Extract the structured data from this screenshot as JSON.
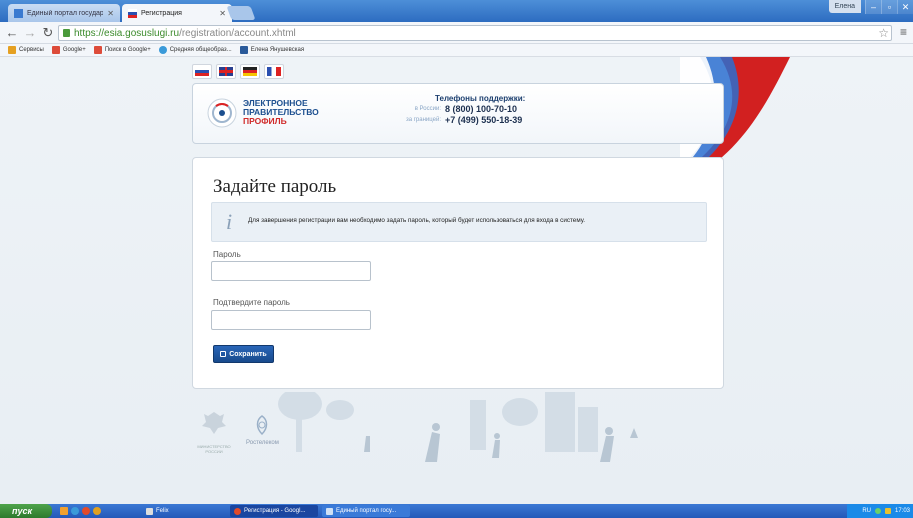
{
  "browser": {
    "tabs": [
      {
        "title": "Единый портал государств",
        "active": false
      },
      {
        "title": "Регистрация",
        "active": true
      }
    ],
    "user_label": "Елена",
    "url_scheme": "https://",
    "url_host": "esia.gosuslugi.ru",
    "url_path": "/registration/account.xhtml",
    "bookmarks": [
      {
        "label": "Сервисы",
        "color": "#e5a021"
      },
      {
        "label": "Google+",
        "color": "#dd4b39"
      },
      {
        "label": "Поиск в Google+",
        "color": "#dd4b39"
      },
      {
        "label": "Средняя общеобраз...",
        "color": "#3a9ad9"
      },
      {
        "label": "Елена Янушевская",
        "color": "#2a5a9a"
      }
    ]
  },
  "header": {
    "logo_line1": "ЭЛЕКТРОННОЕ",
    "logo_line2": "ПРАВИТЕЛЬСТВО",
    "logo_line3": "ПРОФИЛЬ",
    "phones_title": "Телефоны поддержки:",
    "phone_ru_label": "в России:",
    "phone_ru": "8 (800) 100-70-10",
    "phone_abroad_label": "за границей:",
    "phone_abroad": "+7 (499) 550-18-39"
  },
  "form": {
    "title": "Задайте пароль",
    "info_text": "Для завершения регистрации вам необходимо задать пароль, который будет использоваться для входа в систему.",
    "password_label": "Пароль",
    "password_value": "",
    "confirm_label": "Подтвердите пароль",
    "confirm_value": "",
    "save_label": "Сохранить"
  },
  "footer": {
    "ministry": "МИНИСТЕРСТВО РОССИИ",
    "rostelecom": "Ростелеком"
  },
  "taskbar": {
    "start_label": "пуск",
    "tasks": [
      {
        "label": "Felix"
      },
      {
        "label": "Регистрация - Googl..."
      },
      {
        "label": "Единый портал госу..."
      }
    ],
    "lang": "RU",
    "time": "17:03"
  },
  "colors": {
    "accent": "#1c4f8f",
    "save_button": "#1f5aa8",
    "ribbon_red": "#d22020",
    "ribbon_blue": "#2b6ed0"
  }
}
